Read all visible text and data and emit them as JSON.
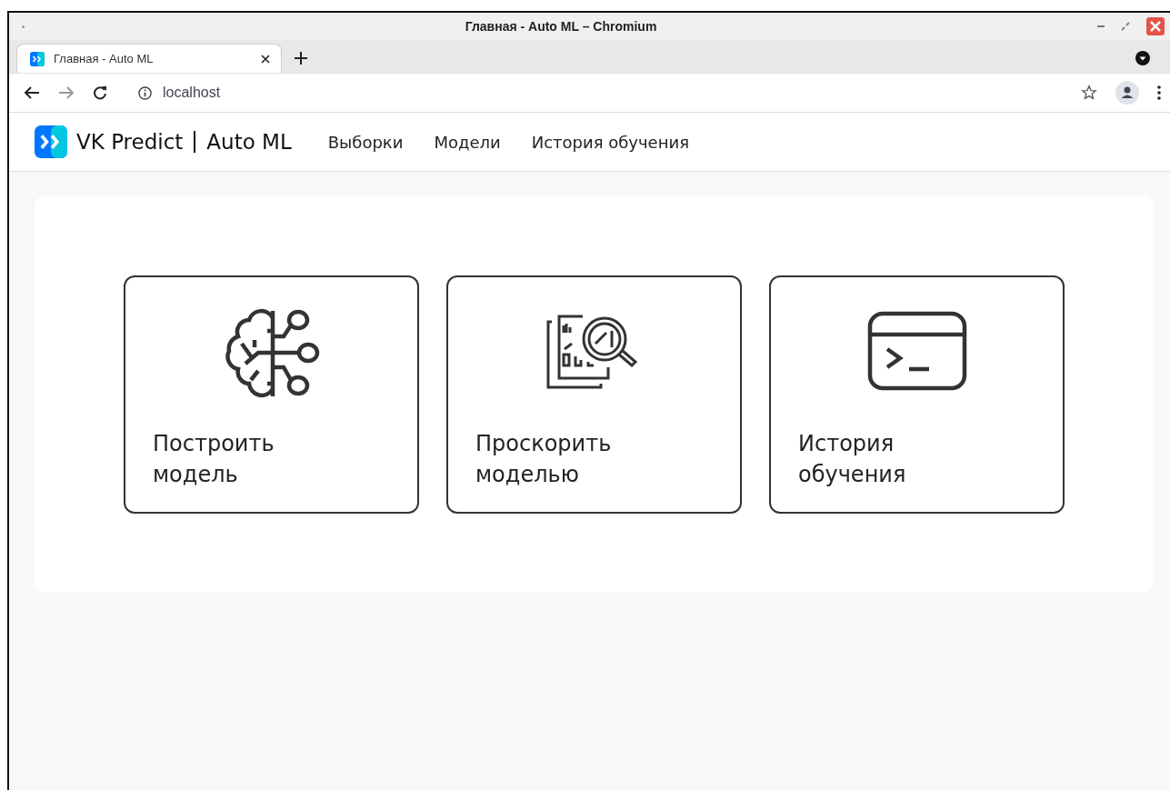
{
  "window": {
    "title": "Главная - Auto ML – Chromium"
  },
  "tabs": [
    {
      "label": "Главная - Auto ML",
      "selected": true
    }
  ],
  "address_bar": {
    "value": "localhost"
  },
  "app": {
    "brand": "VK Predict",
    "product": "Auto ML",
    "nav": [
      {
        "label": "Выборки"
      },
      {
        "label": "Модели"
      },
      {
        "label": "История обучения"
      }
    ]
  },
  "cards": [
    {
      "kind": "brain",
      "title": "Построить модель"
    },
    {
      "kind": "report",
      "title": "Проскорить моделью"
    },
    {
      "kind": "terminal",
      "title": "История обучения"
    }
  ]
}
